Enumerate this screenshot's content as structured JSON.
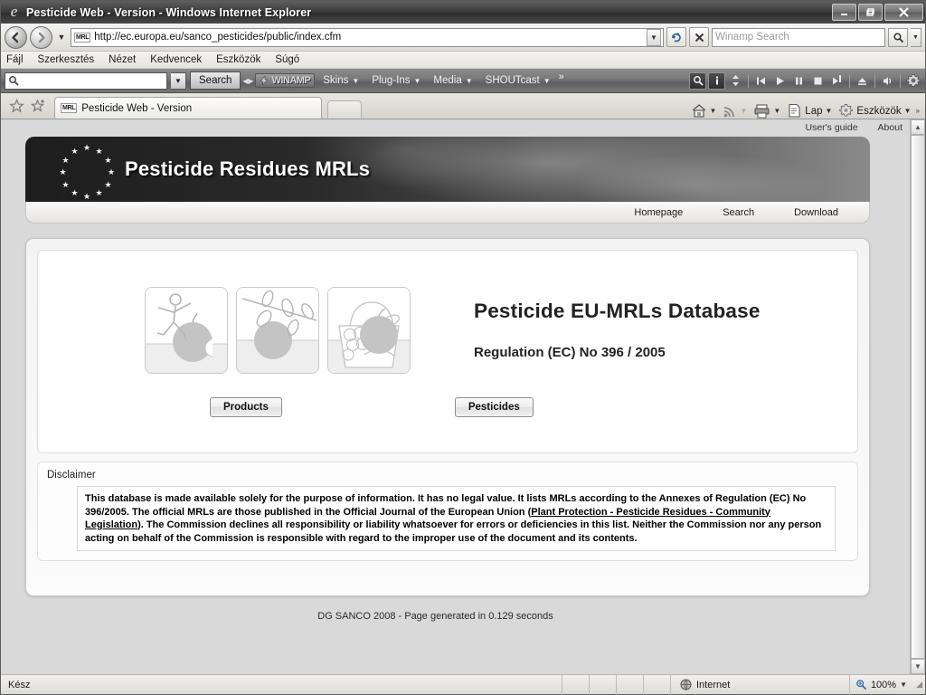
{
  "window": {
    "title": "Pesticide Web - Version - Windows Internet Explorer",
    "minimize_label": "Minimize",
    "restore_label": "Restore",
    "close_label": "Close"
  },
  "toolbar": {
    "back_label": "Back",
    "forward_label": "Forward",
    "recent_pages_label": "Recent Pages",
    "url": "http://ec.europa.eu/sanco_pesticides/public/index.cfm",
    "favicon_label": "MRL",
    "refresh_label": "Refresh",
    "stop_label": "Stop",
    "search_placeholder": "Winamp Search",
    "search_go_label": "Search"
  },
  "menu": {
    "items": [
      {
        "label": "Fájl"
      },
      {
        "label": "Szerkesztés"
      },
      {
        "label": "Nézet"
      },
      {
        "label": "Kedvencek"
      },
      {
        "label": "Eszközök"
      },
      {
        "label": "Súgó"
      }
    ]
  },
  "winamp": {
    "search_value": "",
    "search_button": "Search",
    "brand": "WINAMP",
    "menus": [
      {
        "label": "Skins"
      },
      {
        "label": "Plug-Ins"
      },
      {
        "label": "Media"
      },
      {
        "label": "SHOUTcast"
      }
    ],
    "overflow": "»",
    "controls": [
      {
        "name": "search",
        "label": "Search"
      },
      {
        "name": "info",
        "label": "Info"
      },
      {
        "name": "updown",
        "label": "Volume Up/Down"
      },
      {
        "name": "previous",
        "label": "Previous"
      },
      {
        "name": "play",
        "label": "Play"
      },
      {
        "name": "pause",
        "label": "Pause"
      },
      {
        "name": "stop",
        "label": "Stop"
      },
      {
        "name": "next",
        "label": "Next"
      },
      {
        "name": "eject",
        "label": "Eject"
      },
      {
        "name": "volume",
        "label": "Volume"
      },
      {
        "name": "settings",
        "label": "Settings"
      }
    ]
  },
  "tabs": {
    "favorites_label": "Favorites Center",
    "add_favorite_label": "Add to Favorites",
    "active": {
      "favicon": "MRL",
      "title": "Pesticide Web - Version"
    },
    "new_tab_label": "New Tab"
  },
  "command_bar": {
    "home_label": "Home",
    "feeds_label": "Feeds",
    "print_label": "Print",
    "page_label": "Lap",
    "tools_label": "Eszközök",
    "overflow": "»"
  },
  "page": {
    "top_links": [
      {
        "label": "User's guide"
      },
      {
        "label": "About"
      }
    ],
    "banner_title": "Pesticide Residues MRLs",
    "banner_nav": [
      {
        "label": "Homepage"
      },
      {
        "label": "Search"
      },
      {
        "label": "Download"
      }
    ],
    "hero": {
      "heading": "Pesticide EU-MRLs Database",
      "subheading": "Regulation (EC) No 396 / 2005",
      "thumbs": [
        {
          "name": "person-apple-illustration"
        },
        {
          "name": "branch-fruit-illustration"
        },
        {
          "name": "basket-fruit-illustration"
        }
      ],
      "buttons": [
        {
          "label": "Products"
        },
        {
          "label": "Pesticides"
        }
      ]
    },
    "disclaimer": {
      "title": "Disclaimer",
      "part1": "This database is made available solely for the purpose of information. It has no legal value. It lists MRLs according to the Annexes of Regulation (EC) No 396/2005. The official MRLs are those published in the Official Journal of the European Union (",
      "link": "Plant Protection - Pesticide Residues - Community Legislation",
      "part2": "). The Commission declines all responsibility or liability whatsoever for errors or deficiencies in this list. Neither the Commission nor any person acting on behalf of the Commission is responsible with regard to the improper use of the document and its contents."
    },
    "footer": "DG SANCO 2008 - Page generated in 0.129 seconds"
  },
  "status_bar": {
    "message": "Kész",
    "zone": "Internet",
    "zoom": "100%"
  }
}
